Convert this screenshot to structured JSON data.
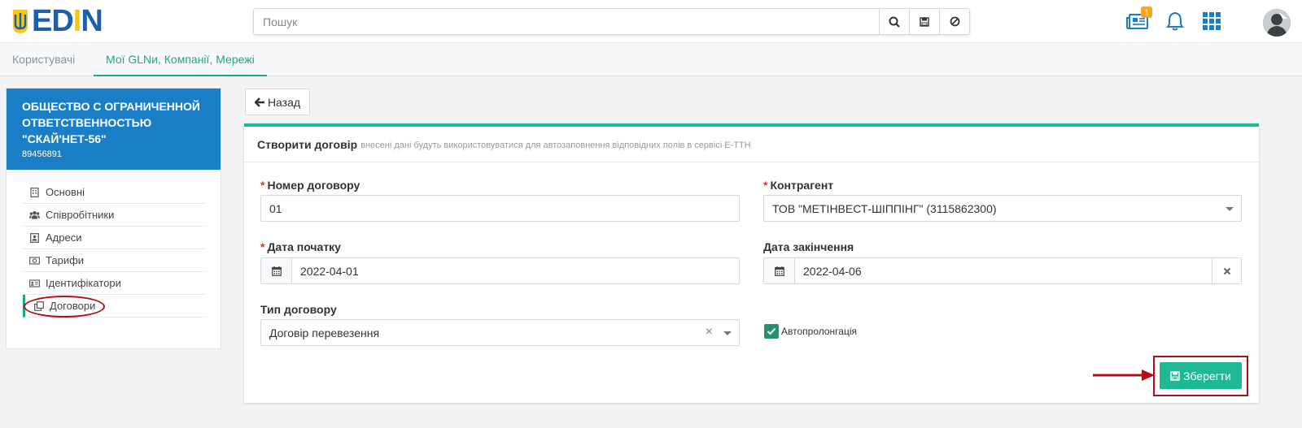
{
  "header": {
    "logo_text": "EDIN",
    "search": {
      "placeholder": "Пошук"
    },
    "notifications_badge": "1",
    "icons": [
      "search-icon",
      "save-icon",
      "ban-icon",
      "news-icon",
      "bell-icon",
      "apps-grid-icon",
      "avatar"
    ]
  },
  "tabs": [
    {
      "label": "Користувачі",
      "active": false
    },
    {
      "label": "Мої GLNи, Компанії, Мережі",
      "active": true
    }
  ],
  "sidebar": {
    "company_name": "ОБЩЕСТВО С ОГРАНИЧЕННОЙ ОТВЕТСТВЕННОСТЬЮ \"СКАЙ'НЕТ-56\"",
    "company_gln": "89456891",
    "items": [
      {
        "label": "Основні",
        "icon": "building-icon"
      },
      {
        "label": "Співробітники",
        "icon": "users-icon"
      },
      {
        "label": "Адреси",
        "icon": "address-icon"
      },
      {
        "label": "Тарифи",
        "icon": "money-icon"
      },
      {
        "label": "Ідентифікатори",
        "icon": "id-card-icon"
      },
      {
        "label": "Договори",
        "icon": "copy-icon",
        "active": true
      }
    ]
  },
  "back_button": "Назад",
  "form": {
    "title": "Створити договір",
    "subtitle": "внесені дані будуть використовуватися для автозаповнення відповідних полів в сервісі Е-ТТН",
    "contract_number": {
      "label": "Номер договору",
      "required": true,
      "value": "01"
    },
    "counterparty": {
      "label": "Контрагент",
      "required": true,
      "value": "ТОВ \"МЕТІНВЕСТ-ШІППІНГ\" (3115862300)"
    },
    "start_date": {
      "label": "Дата початку",
      "required": true,
      "value": "2022-04-01"
    },
    "end_date": {
      "label": "Дата закінчення",
      "required": false,
      "value": "2022-04-06"
    },
    "contract_type": {
      "label": "Тип договору",
      "value": "Договір перевезення"
    },
    "auto_prolongation": {
      "label": "Автопролонгація",
      "checked": true
    },
    "save_label": "Зберегти"
  },
  "colors": {
    "accent": "#1eb895",
    "brand_blue": "#1b7fc7",
    "highlight_red": "#b50d14"
  }
}
